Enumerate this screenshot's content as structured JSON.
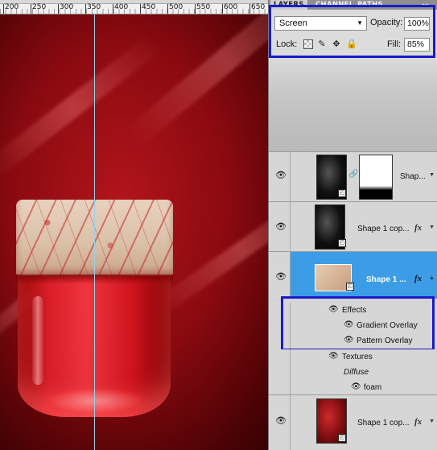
{
  "ruler": {
    "ticks": [
      "200",
      "250",
      "300",
      "350",
      "400",
      "450",
      "500",
      "550",
      "600",
      "650"
    ]
  },
  "panel": {
    "tabs": [
      "LAYERS",
      "CHANNEL",
      "PATHS"
    ],
    "menu_glyph": "▸▸",
    "blend_mode": "Screen",
    "opacity_label": "Opacity:",
    "opacity_value": "100%",
    "lock_label": "Lock:",
    "fill_label": "Fill:",
    "fill_value": "85%"
  },
  "layers": [
    {
      "name": "Shap...",
      "has_mask": true,
      "fx": false,
      "selected": false
    },
    {
      "name": "Shape 1 cop...",
      "has_mask": false,
      "fx": true,
      "selected": false
    },
    {
      "name": "Shape 1 ...",
      "has_mask": false,
      "fx": true,
      "selected": true
    },
    {
      "name": "Shape 1 cop...",
      "has_mask": false,
      "fx": true,
      "selected": false
    }
  ],
  "effects": {
    "header": "Effects",
    "items": [
      "Gradient Overlay",
      "Pattern Overlay"
    ]
  },
  "textures": {
    "header": "Textures",
    "sub": "Diffuse",
    "item": "foam"
  },
  "fx_label": "fx",
  "colors": {
    "selection": "#3d9ce6",
    "highlight_border": "#1a1acc",
    "canvas_red": "#8a0a10"
  },
  "icons": [
    "eye-icon",
    "transparency-lock-icon",
    "brush-lock-icon",
    "move-lock-icon",
    "padlock-icon",
    "chain-link-icon",
    "dropdown-arrow-icon"
  ]
}
